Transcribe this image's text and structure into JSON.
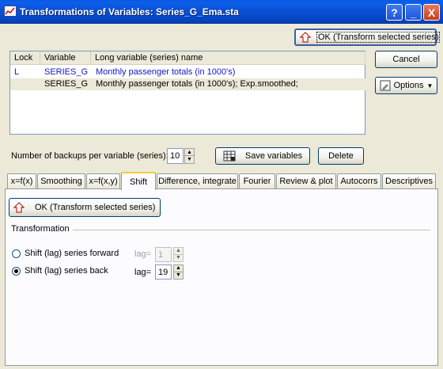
{
  "window": {
    "title": "Transformations of Variables: Series_G_Ema.sta",
    "help": "?",
    "minimize": "_",
    "close": "X"
  },
  "toolbar": {
    "ok_label": "OK (Transform selected series)",
    "cancel_label": "Cancel",
    "options_label": "Options"
  },
  "list": {
    "headers": [
      "Lock",
      "Variable",
      "Long variable (series) name"
    ],
    "rows": [
      {
        "lock": "L",
        "variable": "SERIES_G",
        "name": "Monthly passenger totals (in 1000's)"
      },
      {
        "lock": "",
        "variable": "SERIES_G",
        "name": "Monthly passenger totals (in 1000's); Exp.smoothed;"
      }
    ]
  },
  "backups": {
    "label": "Number of backups per variable (series):",
    "value": "10",
    "save_label": "Save variables",
    "delete_label": "Delete"
  },
  "tabs": [
    "x=f(x)",
    "Smoothing",
    "x=f(x,y)",
    "Shift",
    "Difference, integrate",
    "Fourier",
    "Review & plot",
    "Autocorrs",
    "Descriptives"
  ],
  "shift": {
    "ok_label": "OK (Transform selected series)",
    "group_label": "Transformation",
    "forward_label": "Shift (lag) series forward",
    "back_label": "Shift (lag) series back",
    "lag_label": "lag=",
    "forward_lag": "1",
    "back_lag": "19"
  },
  "colors": {
    "titlebar": "#0a50d6",
    "accent_tab": "#ffc83c",
    "list_blue": "#1515c9"
  },
  "icons": [
    "statistica-app-icon",
    "undo-arrow-icon",
    "save-grid-icon",
    "options-tool-icon",
    "chevron-down-icon",
    "spin-up-icon",
    "spin-down-icon"
  ]
}
